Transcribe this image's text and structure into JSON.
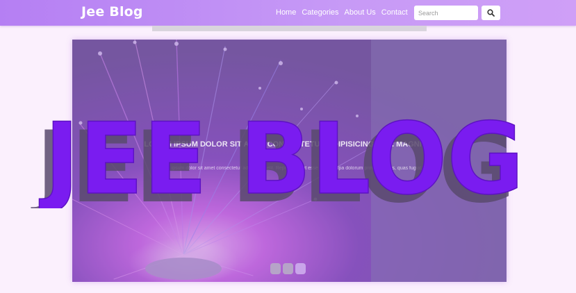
{
  "brand": "Jee Blog",
  "nav": {
    "links": [
      "Home",
      "Categories",
      "About Us",
      "Contact"
    ]
  },
  "search": {
    "placeholder": "Search",
    "button_icon": "search-icon"
  },
  "hero": {
    "overlay_title": "JEE BLOG",
    "caption_title": "Lorem ipsum dolor sit amet consectetur adipisicing elit. Magni et.",
    "caption_text": "Lorem ipsum dolor sit amet consectetur adipisicing elit. Reprehenderit esse sequi culpa dolorum provident quis, quas fugiat.",
    "slide_count": 3,
    "active_slide": 3
  },
  "colors": {
    "navbar": "#b57ff3",
    "title_fill": "#7a1cf0",
    "title_shadow": "#5a4a6e",
    "page_bg": "#fbf0fd"
  }
}
